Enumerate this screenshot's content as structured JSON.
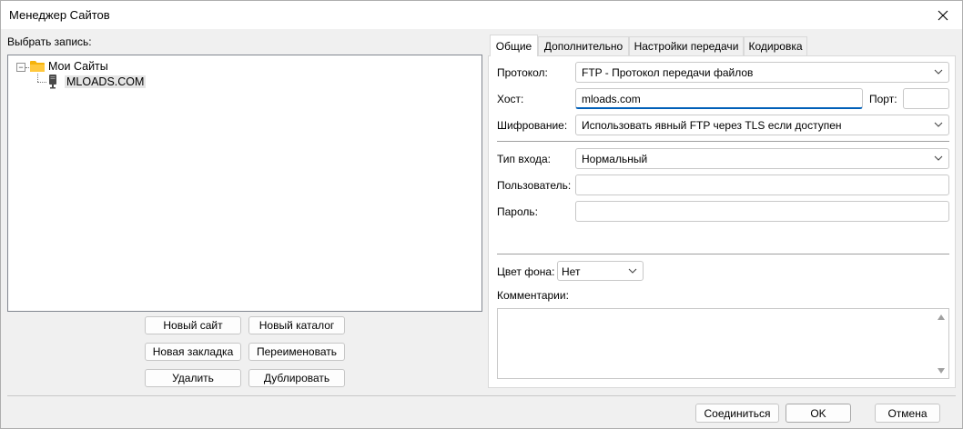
{
  "window": {
    "title": "Менеджер Сайтов"
  },
  "left": {
    "select_label": "Выбрать запись:",
    "tree": {
      "root_label": "Мои Сайты",
      "child_label": "MLOADS.COM"
    },
    "buttons": {
      "new_site": "Новый сайт",
      "new_folder": "Новый каталог",
      "new_bookmark": "Новая закладка",
      "rename": "Переименовать",
      "delete": "Удалить",
      "duplicate": "Дублировать"
    }
  },
  "tabs": [
    "Общие",
    "Дополнительно",
    "Настройки передачи",
    "Кодировка"
  ],
  "general": {
    "protocol_label": "Протокол:",
    "protocol_value": "FTP - Протокол передачи файлов",
    "host_label": "Хост:",
    "host_value": "mloads.com",
    "port_label": "Порт:",
    "port_value": "",
    "encryption_label": "Шифрование:",
    "encryption_value": "Использовать явный FTP через TLS если доступен",
    "logon_label": "Тип входа:",
    "logon_value": "Нормальный",
    "user_label": "Пользователь:",
    "user_value": "",
    "password_label": "Пароль:",
    "password_value": "",
    "bgcolor_label": "Цвет фона:",
    "bgcolor_value": "Нет",
    "comments_label": "Комментарии:"
  },
  "footer": {
    "connect": "Соединиться",
    "ok": "OK",
    "cancel": "Отмена"
  },
  "colors": {
    "focus_accent": "#005fb8",
    "folder": "#f5b30b"
  }
}
